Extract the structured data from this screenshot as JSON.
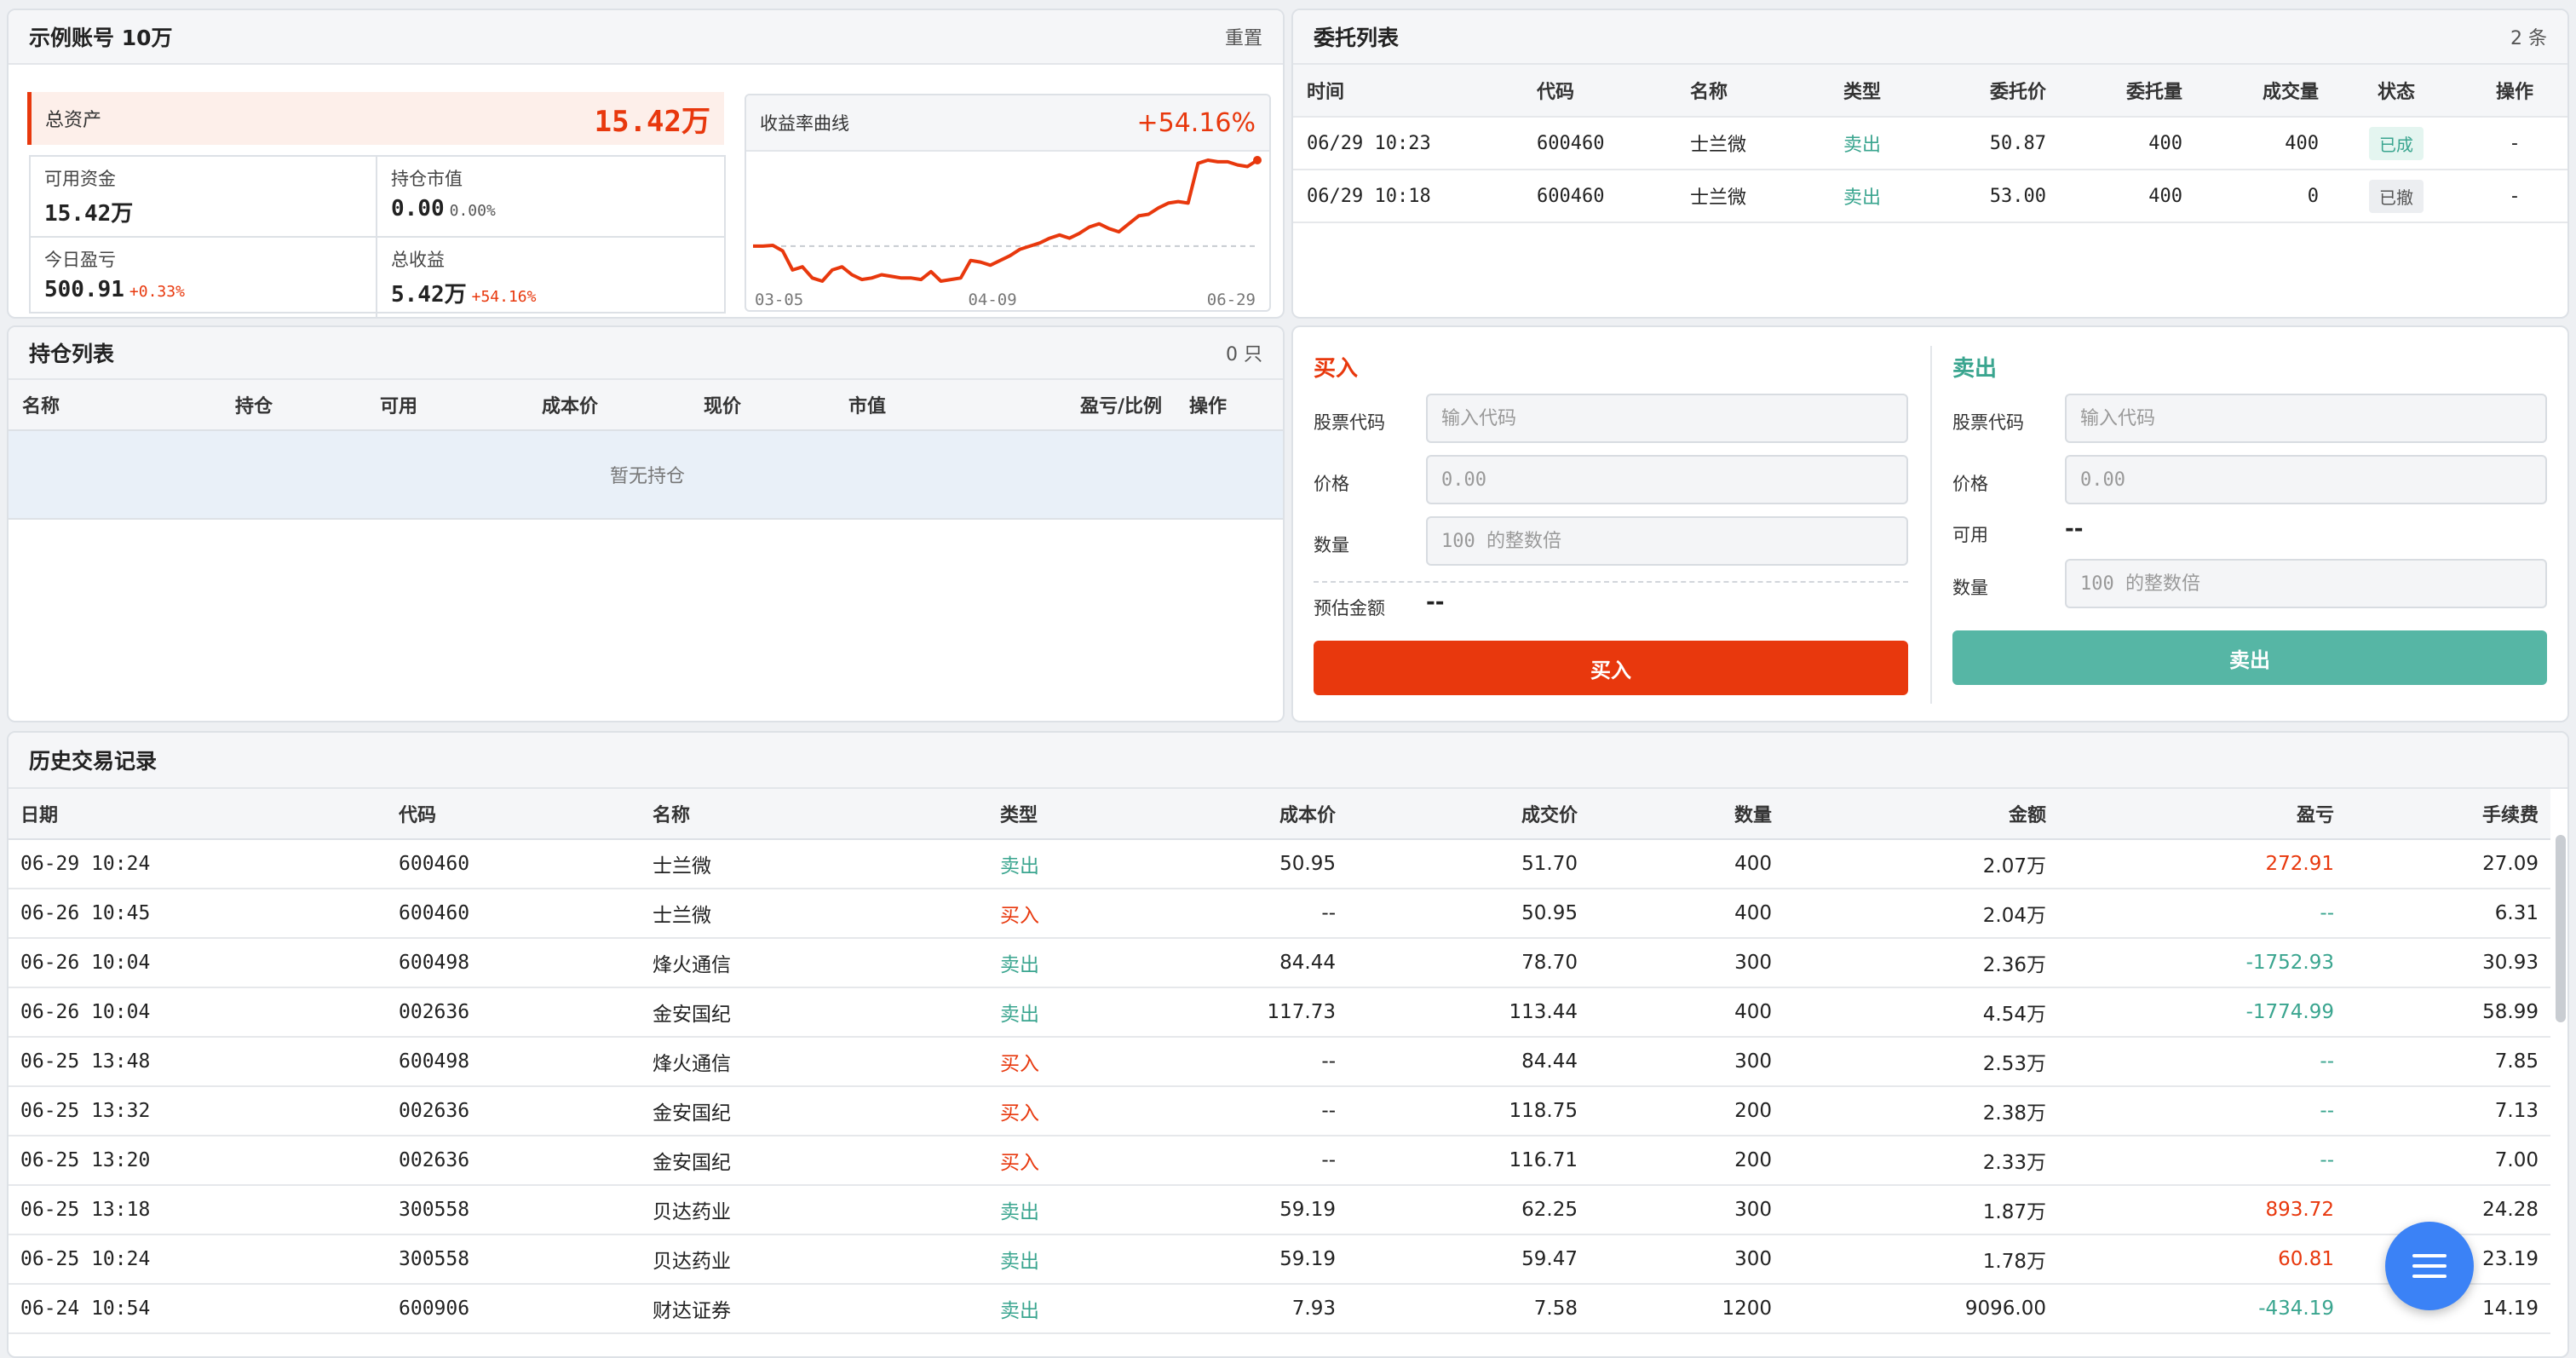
{
  "account": {
    "title": "示例账号 10万",
    "reset_label": "重置",
    "total_assets_label": "总资产",
    "total_assets_value": "15.42万",
    "stats": [
      {
        "label": "可用资金",
        "value": "15.42万",
        "sub": ""
      },
      {
        "label": "持仓市值",
        "value": "0.00",
        "sub": "0.00%"
      },
      {
        "label": "今日盈亏",
        "value": "500.91",
        "sub": "+0.33%"
      },
      {
        "label": "总收益",
        "value": "5.42万",
        "sub": "+54.16%"
      }
    ],
    "curve": {
      "title": "收益率曲线",
      "return_pct": "+54.16%",
      "x_ticks": [
        "03-05",
        "04-09",
        "06-29"
      ]
    }
  },
  "chart_data": {
    "type": "line",
    "title": "收益率曲线",
    "x_ticks": [
      "03-05",
      "04-09",
      "06-29"
    ],
    "values": [
      0.0,
      0.0,
      0.5,
      -3,
      -15,
      -13,
      -20,
      -22,
      -15,
      -13,
      -18,
      -21,
      -20,
      -18,
      -19,
      -20,
      -20,
      -21,
      -16,
      -22,
      -21,
      -20,
      -9,
      -10,
      -12,
      -9,
      -6,
      -2,
      0,
      2,
      5,
      7,
      5,
      8,
      12,
      14,
      11,
      9,
      14,
      19,
      20,
      24,
      27,
      28,
      27,
      52,
      54,
      53,
      53,
      51,
      50,
      54
    ],
    "baseline": 0,
    "color": "#e8380d"
  },
  "orders": {
    "title": "委托列表",
    "count_label": "2 条",
    "columns": [
      "时间",
      "代码",
      "名称",
      "类型",
      "委托价",
      "委托量",
      "成交量",
      "状态",
      "操作"
    ],
    "rows": [
      {
        "time": "06/29 10:23",
        "code": "600460",
        "name": "士兰微",
        "type": "卖出",
        "price": "50.87",
        "qty": "400",
        "filled": "400",
        "status": "已成",
        "op": "-"
      },
      {
        "time": "06/29 10:18",
        "code": "600460",
        "name": "士兰微",
        "type": "卖出",
        "price": "53.00",
        "qty": "400",
        "filled": "0",
        "status": "已撤",
        "op": "-"
      }
    ]
  },
  "positions": {
    "title": "持仓列表",
    "count_label": "0 只",
    "columns": [
      "名称",
      "持仓",
      "可用",
      "成本价",
      "现价",
      "市值",
      "盈亏/比例",
      "操作"
    ],
    "empty_text": "暂无持仓"
  },
  "buy": {
    "title": "买入",
    "code_label": "股票代码",
    "code_placeholder": "输入代码",
    "price_label": "价格",
    "price_placeholder": "0.00",
    "qty_label": "数量",
    "qty_placeholder": "100 的整数倍",
    "estimate_label": "预估金额",
    "estimate_value": "--",
    "button_label": "买入",
    "color": "#e8380d"
  },
  "sell": {
    "title": "卖出",
    "code_label": "股票代码",
    "code_placeholder": "输入代码",
    "price_label": "价格",
    "price_placeholder": "0.00",
    "available_label": "可用",
    "available_value": "--",
    "qty_label": "数量",
    "qty_placeholder": "100 的整数倍",
    "button_label": "卖出",
    "color": "#56b6a5"
  },
  "history": {
    "title": "历史交易记录",
    "columns": [
      "日期",
      "代码",
      "名称",
      "类型",
      "成本价",
      "成交价",
      "数量",
      "金额",
      "盈亏",
      "手续费"
    ],
    "rows": [
      {
        "date": "06-29 10:24",
        "code": "600460",
        "name": "士兰微",
        "type": "卖出",
        "cost": "50.95",
        "price": "51.70",
        "qty": "400",
        "amount": "2.07万",
        "pnl": "272.91",
        "fee": "27.09"
      },
      {
        "date": "06-26 10:45",
        "code": "600460",
        "name": "士兰微",
        "type": "买入",
        "cost": "--",
        "price": "50.95",
        "qty": "400",
        "amount": "2.04万",
        "pnl": "--",
        "fee": "6.31"
      },
      {
        "date": "06-26 10:04",
        "code": "600498",
        "name": "烽火通信",
        "type": "卖出",
        "cost": "84.44",
        "price": "78.70",
        "qty": "300",
        "amount": "2.36万",
        "pnl": "-1752.93",
        "fee": "30.93"
      },
      {
        "date": "06-26 10:04",
        "code": "002636",
        "name": "金安国纪",
        "type": "卖出",
        "cost": "117.73",
        "price": "113.44",
        "qty": "400",
        "amount": "4.54万",
        "pnl": "-1774.99",
        "fee": "58.99"
      },
      {
        "date": "06-25 13:48",
        "code": "600498",
        "name": "烽火通信",
        "type": "买入",
        "cost": "--",
        "price": "84.44",
        "qty": "300",
        "amount": "2.53万",
        "pnl": "--",
        "fee": "7.85"
      },
      {
        "date": "06-25 13:32",
        "code": "002636",
        "name": "金安国纪",
        "type": "买入",
        "cost": "--",
        "price": "118.75",
        "qty": "200",
        "amount": "2.38万",
        "pnl": "--",
        "fee": "7.13"
      },
      {
        "date": "06-25 13:20",
        "code": "002636",
        "name": "金安国纪",
        "type": "买入",
        "cost": "--",
        "price": "116.71",
        "qty": "200",
        "amount": "2.33万",
        "pnl": "--",
        "fee": "7.00"
      },
      {
        "date": "06-25 13:18",
        "code": "300558",
        "name": "贝达药业",
        "type": "卖出",
        "cost": "59.19",
        "price": "62.25",
        "qty": "300",
        "amount": "1.87万",
        "pnl": "893.72",
        "fee": "24.28"
      },
      {
        "date": "06-25 10:24",
        "code": "300558",
        "name": "贝达药业",
        "type": "卖出",
        "cost": "59.19",
        "price": "59.47",
        "qty": "300",
        "amount": "1.78万",
        "pnl": "60.81",
        "fee": "23.19"
      },
      {
        "date": "06-24 10:54",
        "code": "600906",
        "name": "财达证券",
        "type": "卖出",
        "cost": "7.93",
        "price": "7.58",
        "qty": "1200",
        "amount": "9096.00",
        "pnl": "-434.19",
        "fee": "14.19"
      }
    ]
  },
  "fab": {
    "icon": "menu-icon",
    "color": "#3b82f6"
  }
}
